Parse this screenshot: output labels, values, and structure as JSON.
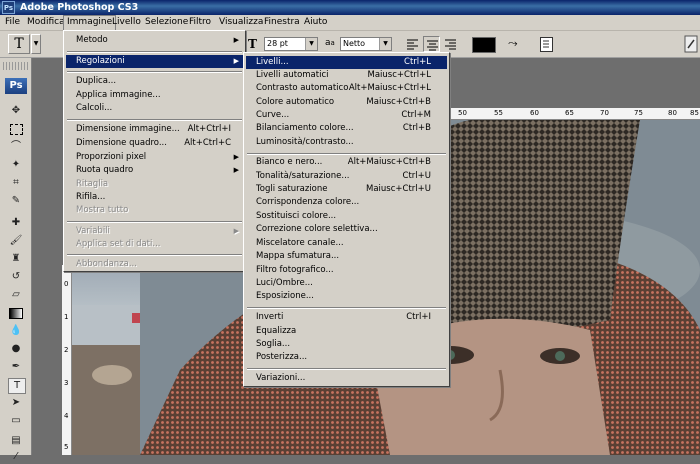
{
  "window": {
    "title": "Adobe Photoshop CS3",
    "logo": "Ps"
  },
  "menubar": [
    "File",
    "Modifica",
    "Immagine",
    "Livello",
    "Selezione",
    "Filtro",
    "Visualizza",
    "Finestra",
    "Aiuto"
  ],
  "options": {
    "tool_glyph": "T",
    "font_size": "28 pt",
    "aa_label": "a",
    "aa_value": "Netto"
  },
  "toolbox": {
    "logo": "Ps"
  },
  "rulers": {
    "h_ticks": [
      "50",
      "55",
      "60",
      "65",
      "70",
      "75",
      "80",
      "85"
    ],
    "v_ticks": [
      "0",
      "1",
      "2",
      "3",
      "4",
      "5"
    ]
  },
  "immagine_menu": [
    {
      "label": "Metodo",
      "arrow": true
    },
    {
      "label": "Regolazioni",
      "arrow": true,
      "highlight": true
    },
    {
      "label": "Duplica..."
    },
    {
      "label": "Applica immagine..."
    },
    {
      "label": "Calcoli..."
    },
    {
      "label": "Dimensione immagine...",
      "shortcut": "Alt+Ctrl+I"
    },
    {
      "label": "Dimensione quadro...",
      "shortcut": "Alt+Ctrl+C"
    },
    {
      "label": "Proporzioni pixel",
      "arrow": true
    },
    {
      "label": "Ruota quadro",
      "arrow": true
    },
    {
      "label": "Ritaglia",
      "disabled": true
    },
    {
      "label": "Rifila..."
    },
    {
      "label": "Mostra tutto",
      "disabled": true
    },
    {
      "label": "Variabili",
      "arrow": true,
      "disabled": true
    },
    {
      "label": "Applica set di dati...",
      "disabled": true
    },
    {
      "label": "Abbondanza...",
      "disabled": true
    }
  ],
  "regolazioni_menu": [
    {
      "label": "Livelli...",
      "shortcut": "Ctrl+L",
      "highlight": true
    },
    {
      "label": "Livelli automatici",
      "shortcut": "Maiusc+Ctrl+L"
    },
    {
      "label": "Contrasto automatico",
      "shortcut": "Alt+Maiusc+Ctrl+L"
    },
    {
      "label": "Colore automatico",
      "shortcut": "Maiusc+Ctrl+B"
    },
    {
      "label": "Curve...",
      "shortcut": "Ctrl+M"
    },
    {
      "label": "Bilanciamento colore...",
      "shortcut": "Ctrl+B"
    },
    {
      "label": "Luminosità/contrasto..."
    },
    {
      "label": "Bianco e nero...",
      "shortcut": "Alt+Maiusc+Ctrl+B"
    },
    {
      "label": "Tonalità/saturazione...",
      "shortcut": "Ctrl+U"
    },
    {
      "label": "Togli saturazione",
      "shortcut": "Maiusc+Ctrl+U"
    },
    {
      "label": "Corrispondenza colore..."
    },
    {
      "label": "Sostituisci colore..."
    },
    {
      "label": "Correzione colore selettiva..."
    },
    {
      "label": "Miscelatore canale..."
    },
    {
      "label": "Mappa sfumatura..."
    },
    {
      "label": "Filtro fotografico..."
    },
    {
      "label": "Luci/Ombre..."
    },
    {
      "label": "Esposizione..."
    },
    {
      "label": "Inverti",
      "shortcut": "Ctrl+I"
    },
    {
      "label": "Equalizza"
    },
    {
      "label": "Soglia..."
    },
    {
      "label": "Posterizza..."
    },
    {
      "label": "Variazioni..."
    }
  ],
  "colors": {
    "highlight": "#0a246a",
    "menu_bg": "#d4d0c8",
    "disabled": "#8a8a8a"
  }
}
